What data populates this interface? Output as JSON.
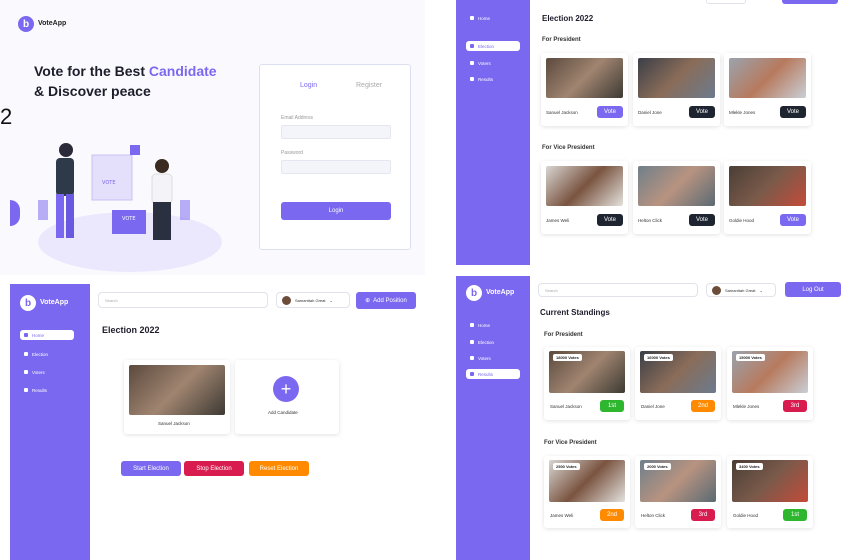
{
  "colors": {
    "accent": "#7b68f0",
    "dark": "#1f2530",
    "red": "#d81c4f",
    "orange": "#ff8a00",
    "green": "#2fb62f"
  },
  "login": {
    "logo_text": "VoteApp",
    "logo_letter": "b",
    "hero_line1_a": "Vote for the Best ",
    "hero_line1_b": "Candidate",
    "hero_line2": "& Discover peace",
    "stray_digit": "2",
    "tab_login": "Login",
    "tab_register": "Register",
    "email_label": "Email Address",
    "password_label": "Password",
    "login_button": "Login"
  },
  "election": {
    "title": "Election 2022",
    "president_heading": "For President",
    "vice_heading": "For Vice President",
    "sidebar": [
      "Home",
      "Election",
      "Voters",
      "Results"
    ],
    "president": [
      {
        "name": "Sanuel Jackson",
        "action": "Vote",
        "style": "purple"
      },
      {
        "name": "Daniel Jone",
        "action": "Vote",
        "style": "dark"
      },
      {
        "name": "Mlekle Jones",
        "action": "Vote",
        "style": "dark"
      }
    ],
    "vice": [
      {
        "name": "James Weli",
        "action": "Vote",
        "style": "dark"
      },
      {
        "name": "Helton Click",
        "action": "Vote",
        "style": "dark"
      },
      {
        "name": "Goldie Hood",
        "action": "Vote",
        "style": "purple"
      }
    ]
  },
  "admin": {
    "logo_text": "VoteApp",
    "logo_letter": "b",
    "search_placeholder": "Search",
    "user_name": "Samanttah Great",
    "add_position": "Add Position",
    "sidebar": [
      "Home",
      "Election",
      "Voters",
      "Results"
    ],
    "title": "Election 2022",
    "candidate_name": "Sanuel Jackson",
    "add_candidate": "Add Candidate",
    "start_button": "Start Election",
    "stop_button": "Stop Election",
    "reset_button": "Reset Election"
  },
  "standings": {
    "logo_text": "VoteApp",
    "logo_letter": "b",
    "search_placeholder": "Search",
    "user_name": "Samanttah Great",
    "logout": "Log Out",
    "sidebar": [
      "Home",
      "Election",
      "Voters",
      "Results"
    ],
    "title": "Current Standings",
    "president_heading": "For President",
    "vice_heading": "For Vice President",
    "president": [
      {
        "name": "Sanuel Jackson",
        "votes": "18000 Votes",
        "rank": "1st",
        "style": "green"
      },
      {
        "name": "Daniel Jone",
        "votes": "16000 Votes",
        "rank": "2nd",
        "style": "orange"
      },
      {
        "name": "Mlekle Jones",
        "votes": "15000 Votes",
        "rank": "3rd",
        "style": "red"
      }
    ],
    "vice": [
      {
        "name": "James Weli",
        "votes": "2500 Votes",
        "rank": "2nd",
        "style": "orange"
      },
      {
        "name": "Helton Click",
        "votes": "2000 Votes",
        "rank": "3rd",
        "style": "red"
      },
      {
        "name": "Goldie Hood",
        "votes": "3400 Votes",
        "rank": "1st",
        "style": "green"
      }
    ]
  }
}
